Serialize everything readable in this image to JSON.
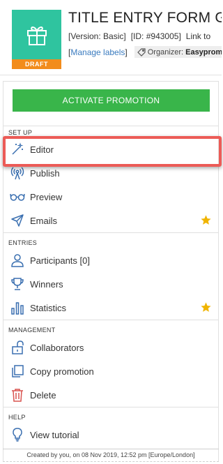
{
  "header": {
    "badge": "DRAFT",
    "title": "TITLE ENTRY FORM GIVEAWAY",
    "version": "[Version: Basic]",
    "id": "[ID: #943005]",
    "link_to": "Link to",
    "manage_labels_open": "[",
    "manage_labels": "Manage labels",
    "manage_labels_close": "]",
    "organizer_label": "Organizer:",
    "organizer_name": "Easypromos"
  },
  "actions": {
    "activate_label": "ACTIVATE PROMOTION"
  },
  "sections": {
    "setup": "SET UP",
    "entries": "ENTRIES",
    "management": "MANAGEMENT",
    "help": "HELP"
  },
  "menu": {
    "editor": "Editor",
    "publish": "Publish",
    "preview": "Preview",
    "emails": "Emails",
    "participants": "Participants [0]",
    "winners": "Winners",
    "statistics": "Statistics",
    "collaborators": "Collaborators",
    "copy_promotion": "Copy promotion",
    "delete": "Delete",
    "view_tutorial": "View tutorial"
  },
  "footer": {
    "created": "Created by you, on 08 Nov 2019, 12:52 pm [Europe/London]"
  },
  "colors": {
    "thumb": "#2fc49f",
    "draft": "#f28c1c",
    "activate": "#39b54a",
    "highlight": "#ec5b57",
    "icon_blue": "#3a6fb0",
    "delete_red": "#d9534f",
    "star": "#f0b400"
  },
  "icons": {
    "thumb": "gift-icon",
    "editor": "magic-wand-icon",
    "publish": "broadcast-icon",
    "preview": "glasses-icon",
    "emails": "paper-plane-icon",
    "participants": "user-icon",
    "winners": "trophy-icon",
    "statistics": "bar-chart-icon",
    "collaborators": "lock-icon",
    "copy_promotion": "copy-icon",
    "delete": "trash-icon",
    "view_tutorial": "lightbulb-icon",
    "star": "star-icon",
    "organizer": "tag-icon"
  }
}
